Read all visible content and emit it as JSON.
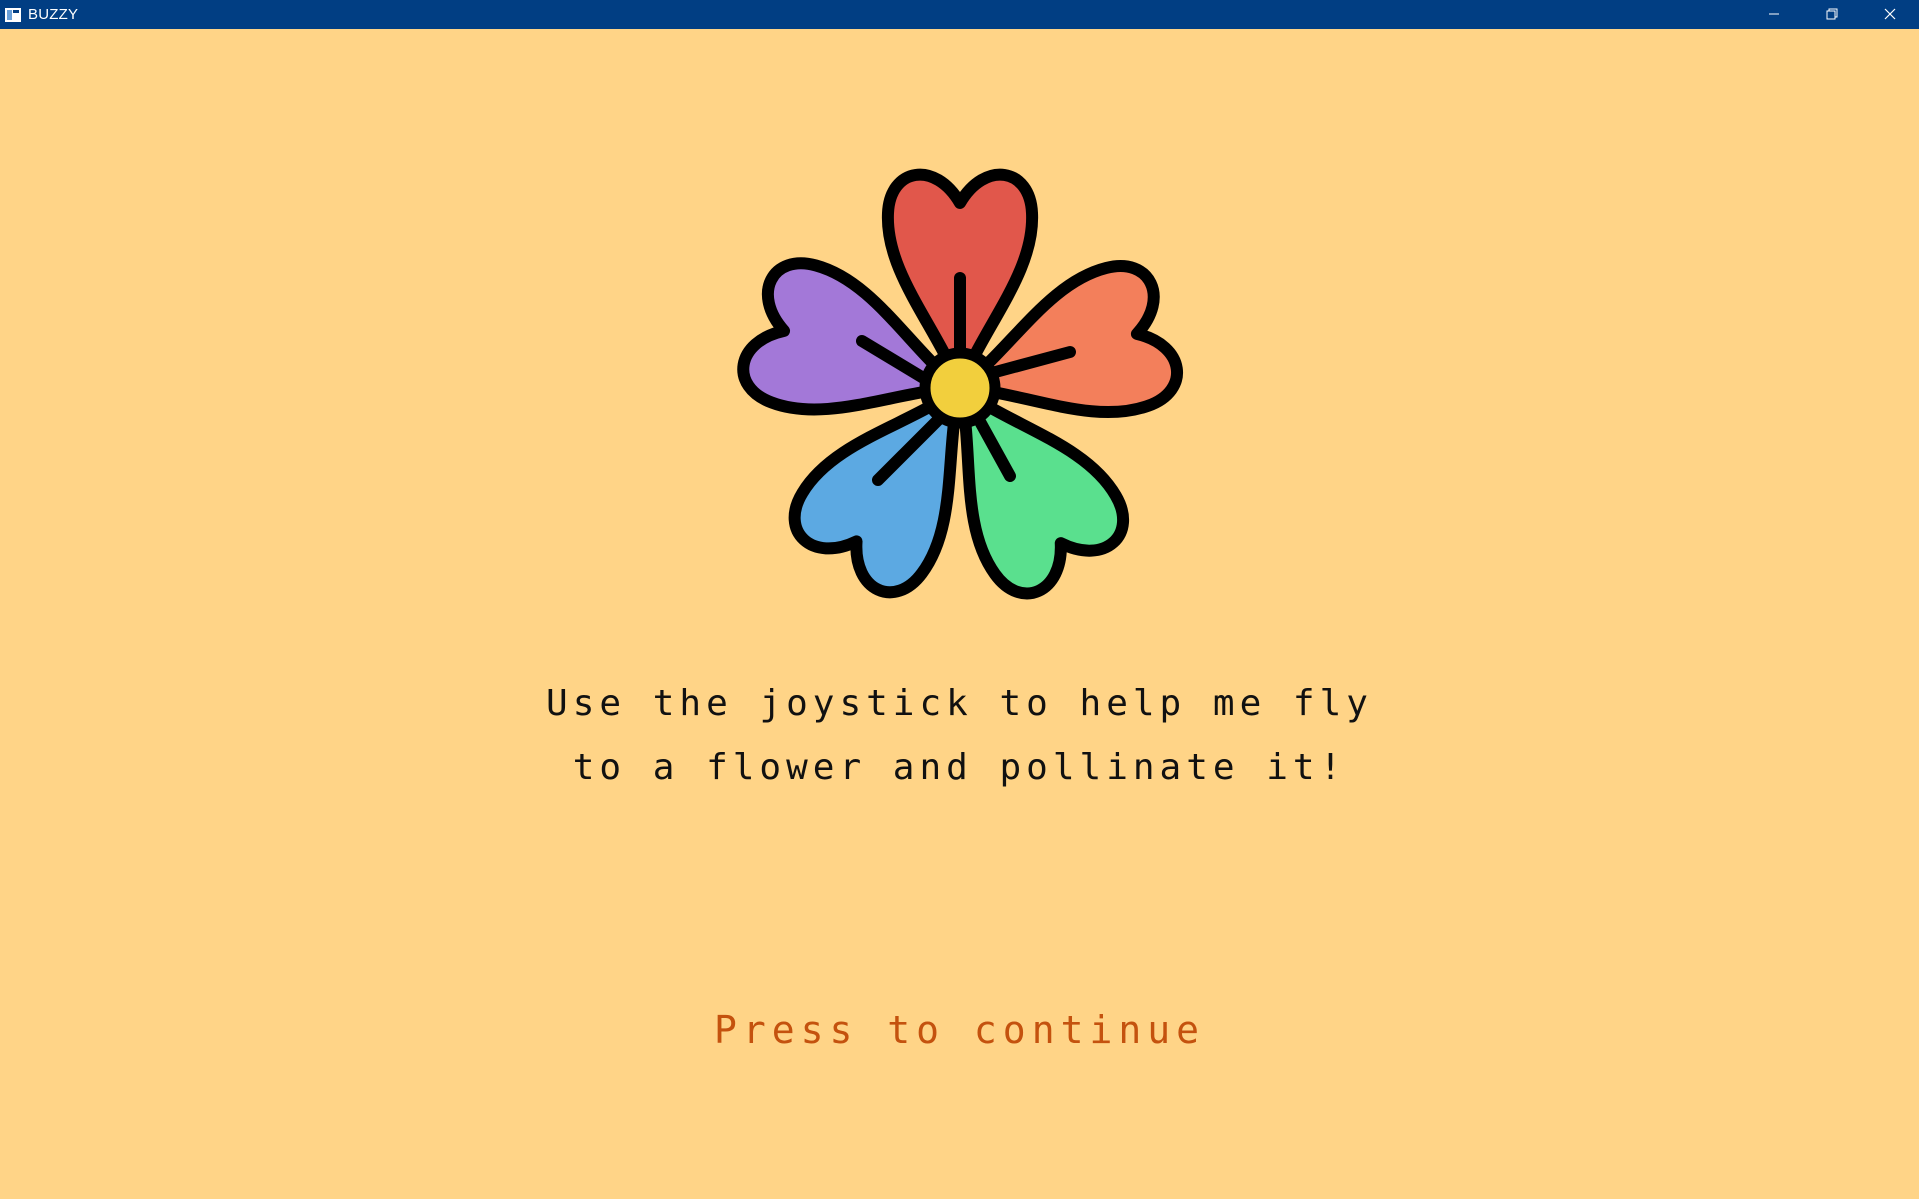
{
  "window": {
    "title": "BUZZY",
    "app_icon": "window-app-icon",
    "controls": [
      "minimize-icon",
      "restore-icon",
      "close-icon"
    ]
  },
  "colors": {
    "background": "#ffd487",
    "titlebar": "#013e83",
    "continue_text": "#c4520e",
    "petal_red": "#e1574b",
    "petal_orange": "#f37f5b",
    "petal_green": "#5ae08e",
    "petal_blue": "#5ca9e2",
    "petal_purple": "#a378d8",
    "center": "#f2cf3d"
  },
  "screen": {
    "illustration": "flower-icon",
    "instruction_line1": "Use the joystick to help me fly",
    "instruction_line2": "to a flower and pollinate it!",
    "continue_prompt": "Press to continue"
  }
}
